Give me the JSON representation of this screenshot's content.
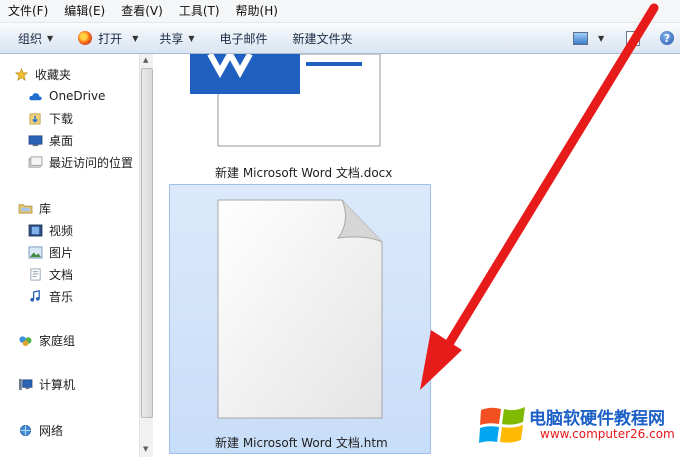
{
  "menu": [
    "文件(F)",
    "编辑(E)",
    "查看(V)",
    "工具(T)",
    "帮助(H)"
  ],
  "toolbar": {
    "organize": "组织",
    "open": "打开",
    "share": "共享",
    "email": "电子邮件",
    "new_folder": "新建文件夹"
  },
  "nav": {
    "favorites": "收藏夹",
    "onedrive": "OneDrive",
    "downloads": "下载",
    "desktop": "桌面",
    "recent": "最近访问的位置",
    "library": "库",
    "videos": "视频",
    "pictures": "图片",
    "documents": "文档",
    "music": "音乐",
    "homegroup": "家庭组",
    "computer": "计算机",
    "network": "网络"
  },
  "files": [
    {
      "name": "新建 Microsoft Word 文档.docx",
      "type": "word-icon"
    },
    {
      "name": "新建 Microsoft Word 文档.htm",
      "type": "blank-file-icon",
      "selected": true
    }
  ],
  "watermark": {
    "title": "电脑软硬件教程网",
    "url": "www.computer26.com"
  },
  "colors": {
    "accent_arrow": "#e81b1b",
    "selection": "#cce0f8",
    "word_blue": "#1f5fc0"
  }
}
